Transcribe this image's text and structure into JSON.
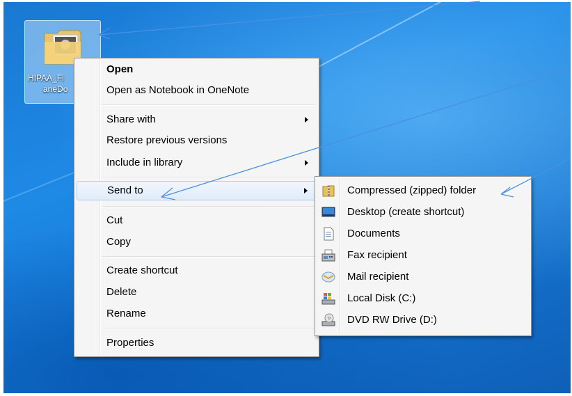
{
  "desktop": {
    "icon": {
      "name": "folder-with-photo-icon",
      "label_line1": "HIPAA_Fi",
      "label_line2": "aneDo"
    }
  },
  "context_menu": {
    "open": "Open",
    "open_onenote": "Open as Notebook in OneNote",
    "share_with": "Share with",
    "restore_versions": "Restore previous versions",
    "include_library": "Include in library",
    "send_to": "Send to",
    "cut": "Cut",
    "copy": "Copy",
    "create_shortcut": "Create shortcut",
    "delete": "Delete",
    "rename": "Rename",
    "properties": "Properties"
  },
  "send_to_menu": {
    "items": [
      {
        "label": "Compressed (zipped) folder",
        "icon": "zip-folder-icon"
      },
      {
        "label": "Desktop (create shortcut)",
        "icon": "desktop-icon"
      },
      {
        "label": "Documents",
        "icon": "documents-icon"
      },
      {
        "label": "Fax recipient",
        "icon": "fax-icon"
      },
      {
        "label": "Mail recipient",
        "icon": "mail-icon"
      },
      {
        "label": "Local Disk (C:)",
        "icon": "local-disk-icon"
      },
      {
        "label": "DVD RW Drive (D:)",
        "icon": "dvd-drive-icon"
      }
    ]
  },
  "colors": {
    "desktop_blue": "#1a7fd8",
    "menu_bg": "#f5f5f5",
    "highlight_border": "#aecff7",
    "annotation_line": "#4a90e2"
  }
}
